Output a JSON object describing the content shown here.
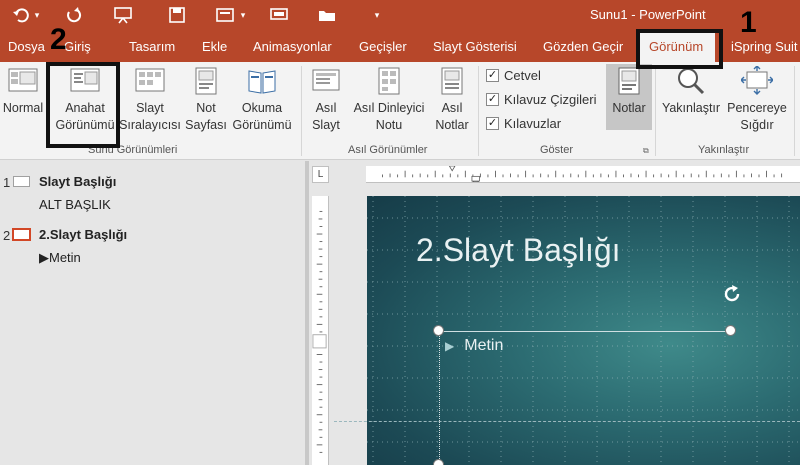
{
  "window": {
    "title": "Sunu1 - PowerPoint"
  },
  "tabs": {
    "dosya": "Dosya",
    "giris": "Giriş",
    "tasarim": "Tasarım",
    "ekle": "Ekle",
    "animasyonlar": "Animasyonlar",
    "gecisler": "Geçişler",
    "slayt_gosterisi": "Slayt Gösterisi",
    "gozden_gecir": "Gözden Geçir",
    "gorunum": "Görünüm",
    "ispring": "iSpring Suit"
  },
  "ribbon": {
    "sunu_gorunumleri": {
      "label": "Sunu Görünümleri",
      "normal": "Normal",
      "anahat_1": "Anahat",
      "anahat_2": "Görünümü",
      "siralayici_1": "Slayt",
      "siralayici_2": "Sıralayıcısı",
      "not_1": "Not",
      "not_2": "Sayfası",
      "okuma_1": "Okuma",
      "okuma_2": "Görünümü"
    },
    "asil_gorunumler": {
      "label": "Asıl Görünümler",
      "asil_slayt_1": "Asıl",
      "asil_slayt_2": "Slayt",
      "asil_dinleyici_1": "Asıl Dinleyici",
      "asil_dinleyici_2": "Notu",
      "asil_notlar_1": "Asıl",
      "asil_notlar_2": "Notlar"
    },
    "goster": {
      "label": "Göster",
      "cetvel": "Cetvel",
      "kilavuz_cizgileri": "Kılavuz Çizgileri",
      "kilavuzlar": "Kılavuzlar",
      "cetvel_checked": true,
      "kilavuz_cizgileri_checked": true,
      "kilavuzlar_checked": true
    },
    "notlar": "Notlar",
    "yakinlastir": {
      "label": "Yakınlaştır",
      "yakinlastir": "Yakınlaştır",
      "pencereye_1": "Pencereye",
      "pencereye_2": "Sığdır"
    }
  },
  "callouts": {
    "one": "1",
    "two": "2"
  },
  "outline": {
    "slides": [
      {
        "num": "1",
        "title": "Slayt Başlığı",
        "sub": "ALT BAŞLIK"
      },
      {
        "num": "2",
        "title": "2.Slayt Başlığı",
        "sub": "Metin"
      }
    ]
  },
  "ruler": {
    "corner": "L"
  },
  "slide": {
    "title": "2.Slayt Başlığı",
    "bullet": "Metin"
  },
  "colors": {
    "accent": "#b7472a",
    "slide_bg": "#1c4a55",
    "selected_thumb": "#d24726"
  }
}
